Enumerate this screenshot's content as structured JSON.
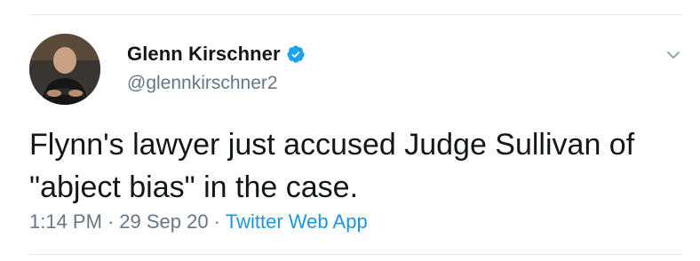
{
  "tweet": {
    "display_name": "Glenn Kirschner",
    "handle": "@glennkirschner2",
    "text_line1": "Flynn's lawyer just accused Judge Sullivan of",
    "text_line2": "\"abject bias\" in the case.",
    "time": "1:14 PM",
    "separator": "·",
    "date": "29 Sep 20",
    "source": "Twitter Web App"
  },
  "icons": {
    "verified": "verified-badge-icon",
    "menu": "chevron-down-icon"
  },
  "colors": {
    "accent": "#1b95e0",
    "text": "#14171a",
    "muted": "#657786",
    "divider": "#e1e8ed"
  }
}
